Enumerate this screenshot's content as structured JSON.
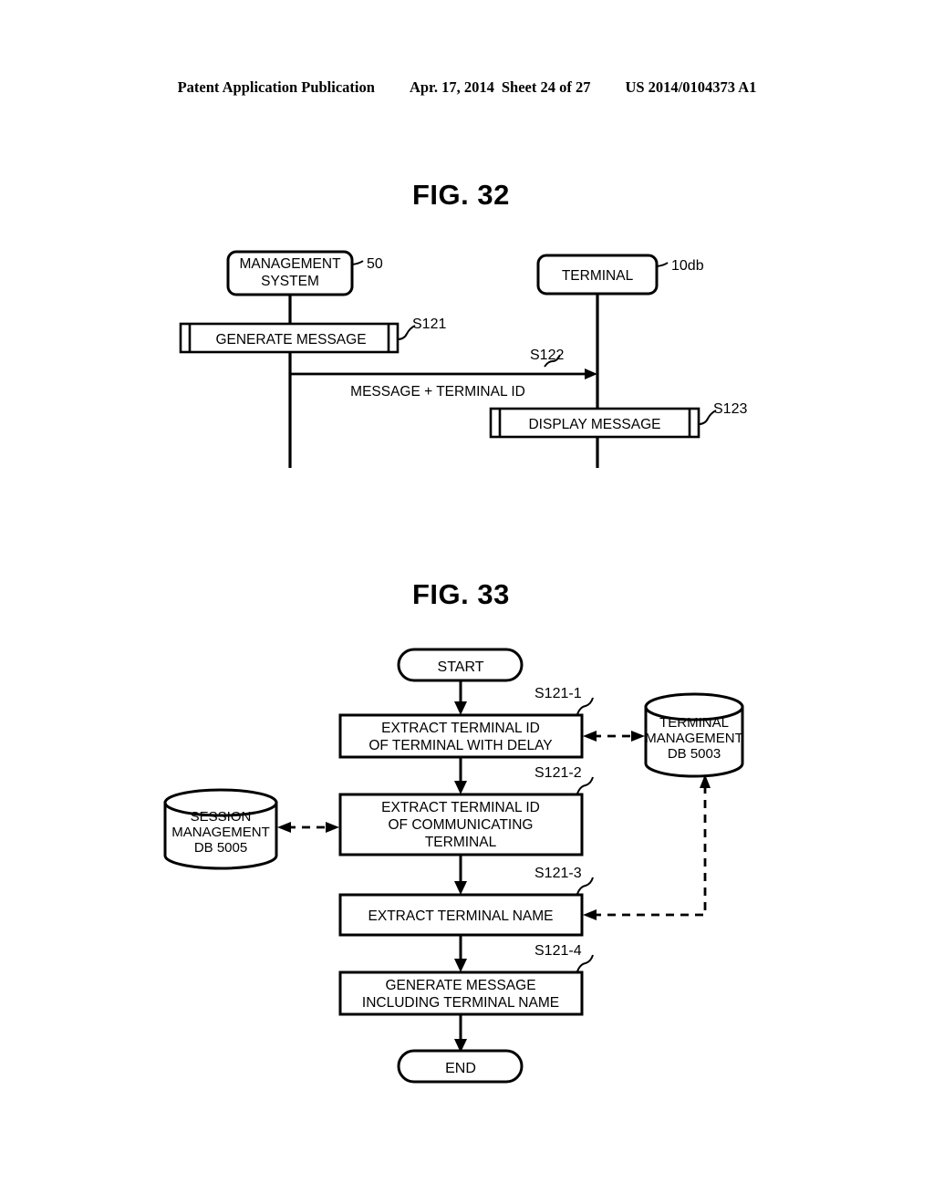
{
  "header": {
    "publication": "Patent Application Publication",
    "date": "Apr. 17, 2014",
    "sheet": "Sheet 24 of 27",
    "patent_number": "US 2014/0104373 A1"
  },
  "figures": [
    {
      "id": "fig32",
      "title": "FIG. 32",
      "type": "sequence-diagram",
      "lifelines": [
        {
          "name": "management-system",
          "label": "MANAGEMENT SYSTEM",
          "label_line1": "MANAGEMENT",
          "label_line2": "SYSTEM",
          "ref": "50"
        },
        {
          "name": "terminal",
          "label": "TERMINAL",
          "label_line1": "TERMINAL",
          "label_line2": "",
          "ref": "10db"
        }
      ],
      "activations": [
        {
          "name": "generate-message",
          "label": "GENERATE MESSAGE",
          "step": "S121",
          "lifeline": "management-system"
        },
        {
          "name": "display-message",
          "label": "DISPLAY MESSAGE",
          "step": "S123",
          "lifeline": "terminal"
        }
      ],
      "messages": [
        {
          "name": "message-terminal-id",
          "label": "MESSAGE + TERMINAL ID",
          "step": "S122",
          "from": "management-system",
          "to": "terminal",
          "direction": "right"
        }
      ]
    },
    {
      "id": "fig33",
      "title": "FIG. 33",
      "type": "flowchart",
      "nodes": [
        {
          "name": "start-terminator",
          "shape": "terminator",
          "label": "START"
        },
        {
          "name": "extract-terminal-id-delay",
          "shape": "process",
          "step": "S121-1",
          "label_line1": "EXTRACT TERMINAL ID",
          "label_line2": "OF TERMINAL WITH DELAY",
          "label_line3": ""
        },
        {
          "name": "extract-terminal-id-communicating",
          "shape": "process",
          "step": "S121-2",
          "label_line1": "EXTRACT TERMINAL ID",
          "label_line2": "OF COMMUNICATING",
          "label_line3": "TERMINAL"
        },
        {
          "name": "extract-terminal-name",
          "shape": "process",
          "step": "S121-3",
          "label_line1": "EXTRACT TERMINAL NAME",
          "label_line2": "",
          "label_line3": ""
        },
        {
          "name": "generate-message-with-name",
          "shape": "process",
          "step": "S121-4",
          "label_line1": "GENERATE MESSAGE",
          "label_line2": "INCLUDING TERMINAL NAME",
          "label_line3": ""
        },
        {
          "name": "end-terminator",
          "shape": "terminator",
          "label": "END"
        }
      ],
      "datastores": [
        {
          "name": "terminal-management-db",
          "line1": "TERMINAL",
          "line2": "MANAGEMENT",
          "line3": "DB 5003"
        },
        {
          "name": "session-management-db",
          "line1": "SESSION",
          "line2": "MANAGEMENT",
          "line3": "DB 5005"
        }
      ],
      "connections": [
        {
          "name": "db-link-terminal-mgmt-s121-1",
          "style": "dashed",
          "arrows": "both"
        },
        {
          "name": "db-link-session-mgmt-s121-2",
          "style": "dashed",
          "arrows": "both"
        },
        {
          "name": "db-link-terminal-mgmt-s121-3",
          "style": "dashed",
          "arrows": "to-process"
        }
      ]
    }
  ],
  "colors": {
    "ink": "#000000",
    "paper": "#ffffff"
  }
}
